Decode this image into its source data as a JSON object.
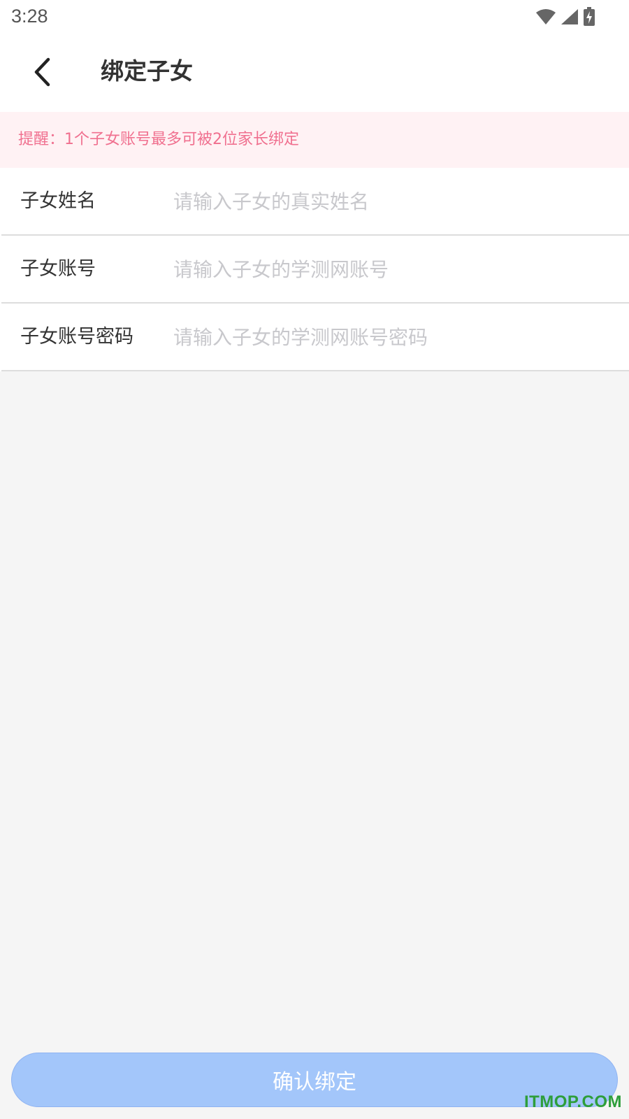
{
  "status_bar": {
    "time": "3:28",
    "icons": [
      "wifi-icon",
      "signal-icon",
      "battery-charging-icon"
    ]
  },
  "header": {
    "back_icon": "chevron-left-icon",
    "title": "绑定子女"
  },
  "notice": {
    "text": "提醒：1个子女账号最多可被2位家长绑定",
    "color": "#f0708f",
    "background": "#fff2f4"
  },
  "form": {
    "rows": [
      {
        "label": "子女姓名",
        "value": "",
        "placeholder": "请输入子女的真实姓名"
      },
      {
        "label": "子女账号",
        "value": "",
        "placeholder": "请输入子女的学测网账号"
      },
      {
        "label": "子女账号密码",
        "value": "",
        "placeholder": "请输入子女的学测网账号密码"
      }
    ]
  },
  "confirm_button": {
    "label": "确认绑定",
    "color": "#a3c6fa"
  },
  "watermark": {
    "text": "ITMOP.COM"
  }
}
